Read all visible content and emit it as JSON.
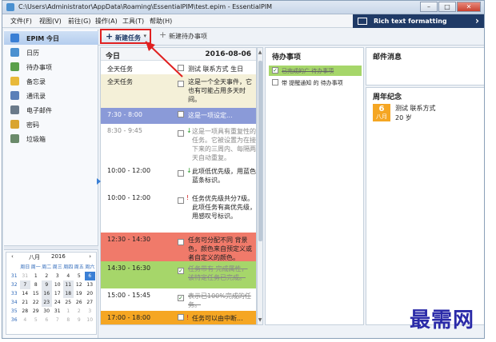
{
  "window": {
    "title": "C:\\Users\\Administrator\\AppData\\Roaming\\EssentialPIM\\test.epim - EssentialPIM"
  },
  "menu": [
    "文件(F)",
    "视图(V)",
    "前往(G)",
    "操作(A)",
    "工具(T)",
    "帮助(H)"
  ],
  "rtf_panel": {
    "label": "Rich text formatting"
  },
  "toolbar": {
    "new_task": "新建任务",
    "new_todo": "新建待办事项"
  },
  "sidebar": {
    "items": [
      {
        "label": "EPIM 今日",
        "color": "#3a7fd5"
      },
      {
        "label": "日历",
        "color": "#4a90d0"
      },
      {
        "label": "待办事项",
        "color": "#5aa04a"
      },
      {
        "label": "备忘录",
        "color": "#e8b93a"
      },
      {
        "label": "通讯录",
        "color": "#5b7fb8"
      },
      {
        "label": "电子邮件",
        "color": "#6a7a8a"
      },
      {
        "label": "密码",
        "color": "#d9a530"
      },
      {
        "label": "垃圾箱",
        "color": "#6a8a6a"
      }
    ]
  },
  "mini_calendar": {
    "month": "八月",
    "year": "2016",
    "weekdays": [
      "",
      "周日",
      "周一",
      "周二",
      "周三",
      "周四",
      "周五",
      "周六"
    ],
    "rows": [
      [
        "31",
        "31",
        "1",
        "2",
        "3",
        "4",
        "5",
        "6"
      ],
      [
        "32",
        "7",
        "8",
        "9",
        "10",
        "11",
        "12",
        "13"
      ],
      [
        "33",
        "14",
        "15",
        "16",
        "17",
        "18",
        "19",
        "20"
      ],
      [
        "34",
        "21",
        "22",
        "23",
        "24",
        "25",
        "26",
        "27"
      ],
      [
        "35",
        "28",
        "29",
        "30",
        "31",
        "1",
        "2",
        "3"
      ],
      [
        "36",
        "4",
        "5",
        "6",
        "7",
        "8",
        "9",
        "10"
      ]
    ]
  },
  "today": {
    "header": "今日",
    "date": "2016-08-06",
    "rows": [
      {
        "time": "全天任务",
        "text": "测试 联系方式 生日",
        "bg": "#ffffff",
        "check": false,
        "mark": "",
        "strike": false
      },
      {
        "time": "全天任务",
        "text": "这是一个全天事件，它也有可能占用多天时间。",
        "bg": "#f4f0d8",
        "check": false,
        "mark": "",
        "strike": false
      },
      {
        "time": "7:30 - 8:00",
        "text": "这是一项设定...",
        "bg": "#8a9ad8",
        "check": false,
        "mark": "",
        "strike": false
      },
      {
        "time": "8:30 - 9:45",
        "text": "这是一项具有重复性的任务。它被设置为在接下来的三周内、每隔两天自动重复。",
        "bg": "#ffffff",
        "check": false,
        "mark": "↓",
        "strike": false
      },
      {
        "time": "10:00 - 12:00",
        "text": "此项低优先级，用蓝色蓝条标识。",
        "bg": "#ffffff",
        "check": false,
        "mark": "↓",
        "strike": false
      },
      {
        "time": "10:00 - 12:00",
        "text": "任务优先级共分7级。此项任务有高优先级，用感叹号标识。",
        "bg": "#ffffff",
        "check": false,
        "mark": "!",
        "strike": false
      },
      {
        "time": "12:30 - 14:30",
        "text": "任务可分配不同 背景色，颜色来自预定义或者自定义的颜色。",
        "bg": "#f07a6a",
        "check": false,
        "mark": "",
        "strike": false
      },
      {
        "time": "14:30 - 16:30",
        "text": "任务带有 完成属性，该特定任务已完成。",
        "bg": "#a6d66a",
        "check": true,
        "mark": "",
        "strike": true
      },
      {
        "time": "15:00 - 15:45",
        "text": "表示已100%完成的任务。",
        "bg": "#ffffff",
        "check": true,
        "mark": "",
        "strike": true
      },
      {
        "time": "17:00 - 18:00",
        "text": "任务可以由中断...",
        "bg": "#f5a623",
        "check": false,
        "mark": "!",
        "strike": false
      }
    ]
  },
  "todo": {
    "header": "待办事项",
    "items": [
      {
        "text": "已完成的广 待办事项",
        "done": true,
        "bg": "#a6d66a"
      },
      {
        "text": "带 提醒通知 的 待办事项",
        "done": false,
        "bg": "#ffffff"
      }
    ]
  },
  "mail": {
    "header": "邮件消息"
  },
  "anniversary": {
    "header": "周年纪念",
    "day": "6",
    "month": "八月",
    "name": "测试 联系方式",
    "age": "20 岁"
  },
  "watermark": "最需网"
}
